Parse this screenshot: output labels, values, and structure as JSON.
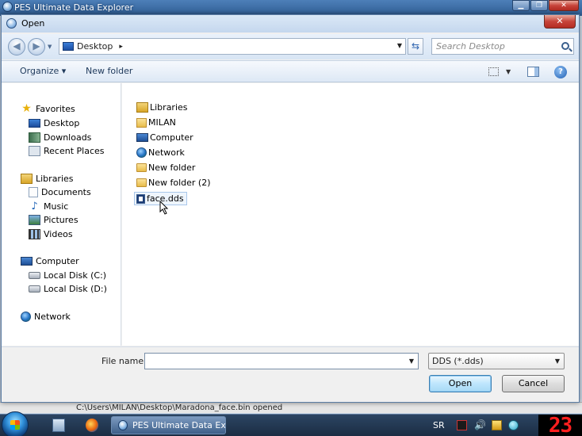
{
  "app": {
    "title": "PES Ultimate Data Explorer",
    "controls": {
      "minimize": "▁",
      "maximize": "❐",
      "close": "✕"
    },
    "status_text": "C:\\Users\\MILAN\\Desktop\\Maradona_face.bin opened"
  },
  "dialog": {
    "title": "Open",
    "close_label": "✕",
    "address": {
      "location": "Desktop",
      "separator": "▸"
    },
    "search": {
      "placeholder": "Search Desktop"
    },
    "toolbar": {
      "organize_label": "Organize ▾",
      "new_folder_label": "New folder",
      "help_label": "?"
    },
    "nav": {
      "favorites": {
        "label": "Favorites",
        "items": [
          "Desktop",
          "Downloads",
          "Recent Places"
        ]
      },
      "libraries": {
        "label": "Libraries",
        "items": [
          "Documents",
          "Music",
          "Pictures",
          "Videos"
        ]
      },
      "computer": {
        "label": "Computer",
        "items": [
          "Local Disk (C:)",
          "Local Disk (D:)"
        ]
      },
      "network": {
        "label": "Network"
      }
    },
    "files": [
      {
        "name": "Libraries",
        "icon": "libraries-icon"
      },
      {
        "name": "MILAN",
        "icon": "user-folder-icon"
      },
      {
        "name": "Computer",
        "icon": "computer-icon"
      },
      {
        "name": "Network",
        "icon": "network-icon"
      },
      {
        "name": "New folder",
        "icon": "folder-icon"
      },
      {
        "name": "New folder (2)",
        "icon": "folder-icon"
      },
      {
        "name": "face.dds",
        "icon": "dds-file-icon",
        "selected": true
      }
    ],
    "file_name": {
      "label": "File name:",
      "value": ""
    },
    "file_type": {
      "selected": "DDS (*.dds)"
    },
    "buttons": {
      "open": "Open",
      "cancel": "Cancel"
    }
  },
  "taskbar": {
    "task_label": "PES Ultimate Data Ex...",
    "language": "SR",
    "clock": "23"
  }
}
